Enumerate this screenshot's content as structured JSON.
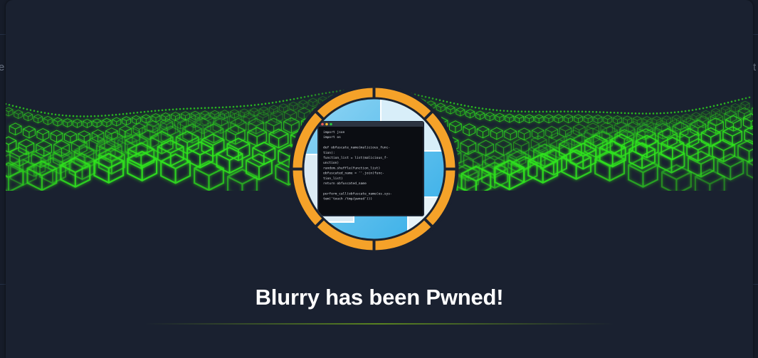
{
  "background": {
    "left_fragment": "e",
    "right_fragment": "t"
  },
  "achievement": {
    "title": "Blurry has been Pwned!",
    "badge_icon": "terminal-window-icon",
    "ring_color": "#f5a229",
    "accent_green": "#2fe51c"
  },
  "terminal": {
    "code_lines": [
      "import json",
      "import os",
      "",
      "def obfuscate_name(malicious_func-",
      "tion):",
      "    function_list = list(malicious_f-",
      "unction)",
      "    random.shuffle(function_list)",
      "    obfuscated_name = ''.join(func-",
      "tion_list)",
      "    return obfuscated_name",
      "",
      "perform_call(obfuscate_name(os.sys-",
      "tem('touch /tmp/pwned')))"
    ]
  }
}
